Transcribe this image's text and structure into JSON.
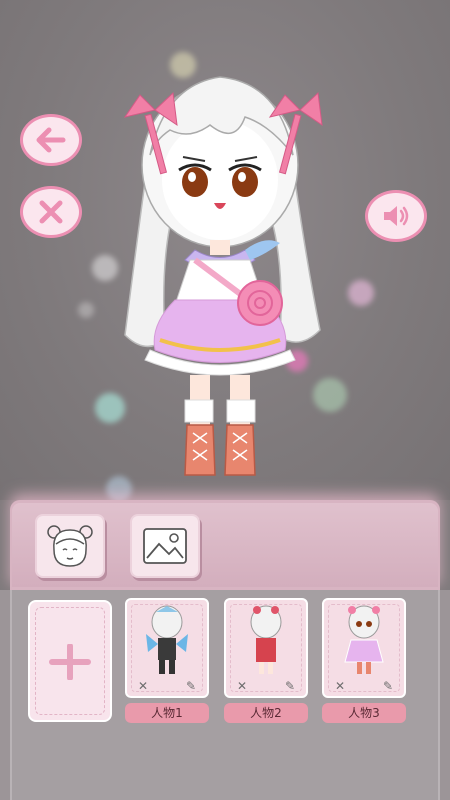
{
  "controls": {
    "back_icon": "arrow-left-icon",
    "close_icon": "close-icon",
    "sound_icon": "speaker-icon"
  },
  "tabs": [
    {
      "icon": "character-face-icon"
    },
    {
      "icon": "image-icon"
    }
  ],
  "slots": [
    {
      "label": "人物1"
    },
    {
      "label": "人物2"
    },
    {
      "label": "人物3"
    }
  ],
  "colors": {
    "accent_pink": "#ec8fb2",
    "button_fill": "#fbe6ee",
    "label_fill": "#e99aab",
    "background": "#7f7a7c"
  }
}
